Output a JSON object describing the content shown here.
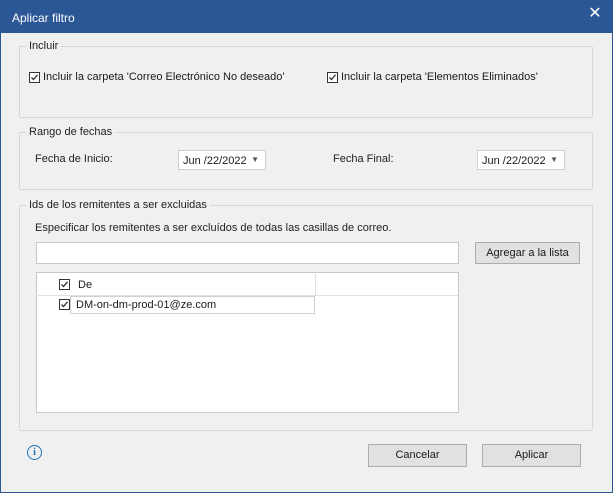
{
  "window": {
    "title": "Aplicar filtro",
    "close_icon": "close-icon"
  },
  "incluir": {
    "legend": "Incluir",
    "junk_label": "Incluir la carpeta 'Correo Electrónico No deseado'",
    "junk_checked": true,
    "deleted_label": "Incluir la carpeta 'Elementos Eliminados'",
    "deleted_checked": true
  },
  "rango": {
    "legend": "Rango de fechas",
    "start_label": "Fecha de Inicio:",
    "start_value": "Jun /22/2022",
    "end_label": "Fecha Final:",
    "end_value": "Jun /22/2022"
  },
  "remitentes": {
    "legend": "Ids de los remitentes a ser excluidas",
    "instruction": "Especificar los remitentes a ser excluídos de todas las casillas de correo.",
    "input_value": "",
    "add_button": "Agregar a la lista",
    "column_header": "De",
    "rows": [
      {
        "email": "DM-on-dm-prod-01@ze.com",
        "checked": true
      }
    ]
  },
  "footer": {
    "info_icon": "info-icon",
    "cancel": "Cancelar",
    "apply": "Aplicar"
  }
}
